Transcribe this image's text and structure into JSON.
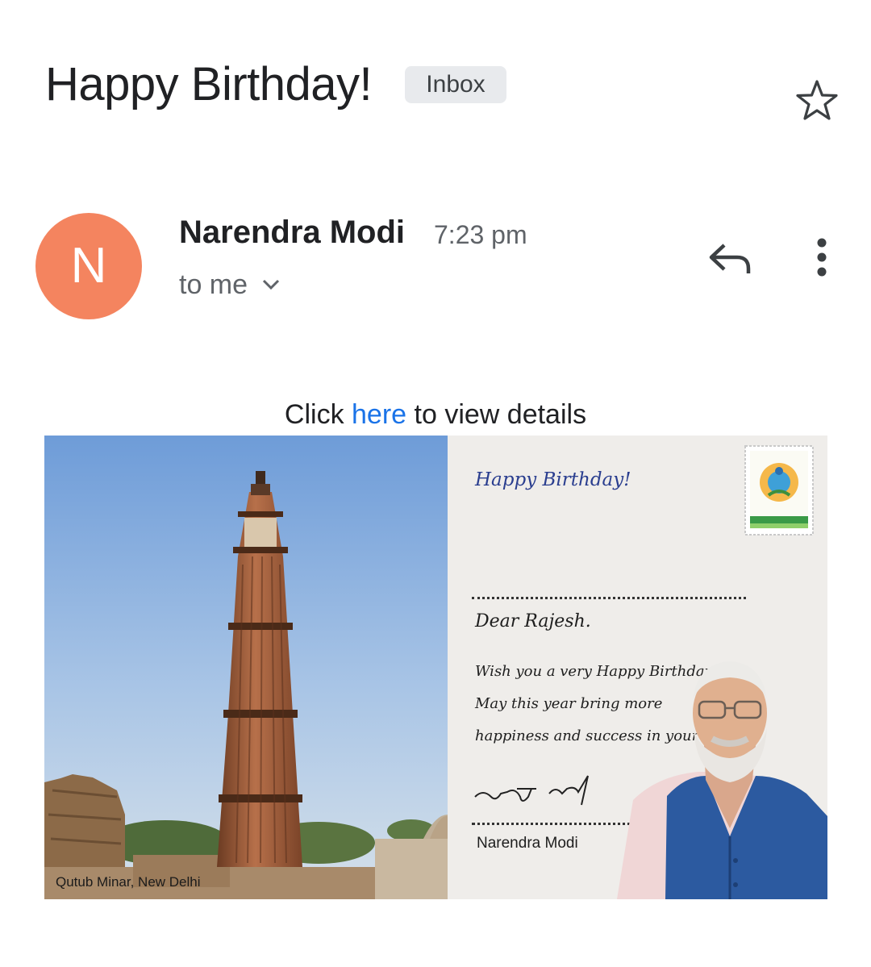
{
  "email": {
    "subject": "Happy Birthday!",
    "label": "Inbox",
    "sender_initial": "N",
    "sender_name": "Narendra Modi",
    "time": "7:23 pm",
    "recipients": "to me"
  },
  "body": {
    "click_prefix": "Click ",
    "click_link": "here",
    "click_suffix": " to view details"
  },
  "card": {
    "photo_caption": "Qutub Minar, New Delhi",
    "greeting_title": "Happy Birthday!",
    "salutation": "Dear Rajesh.",
    "message_lines": [
      "Wish you a very Happy Birthday.",
      "May this year bring more",
      "happiness and success in your life!"
    ],
    "signer_name": "Narendra Modi"
  },
  "colors": {
    "avatar": "#f4845f",
    "link": "#1a73e8",
    "chip_bg": "#e8eaed"
  },
  "icons": [
    "star-icon",
    "reply-icon",
    "more-vert-icon",
    "chevron-down-icon"
  ]
}
